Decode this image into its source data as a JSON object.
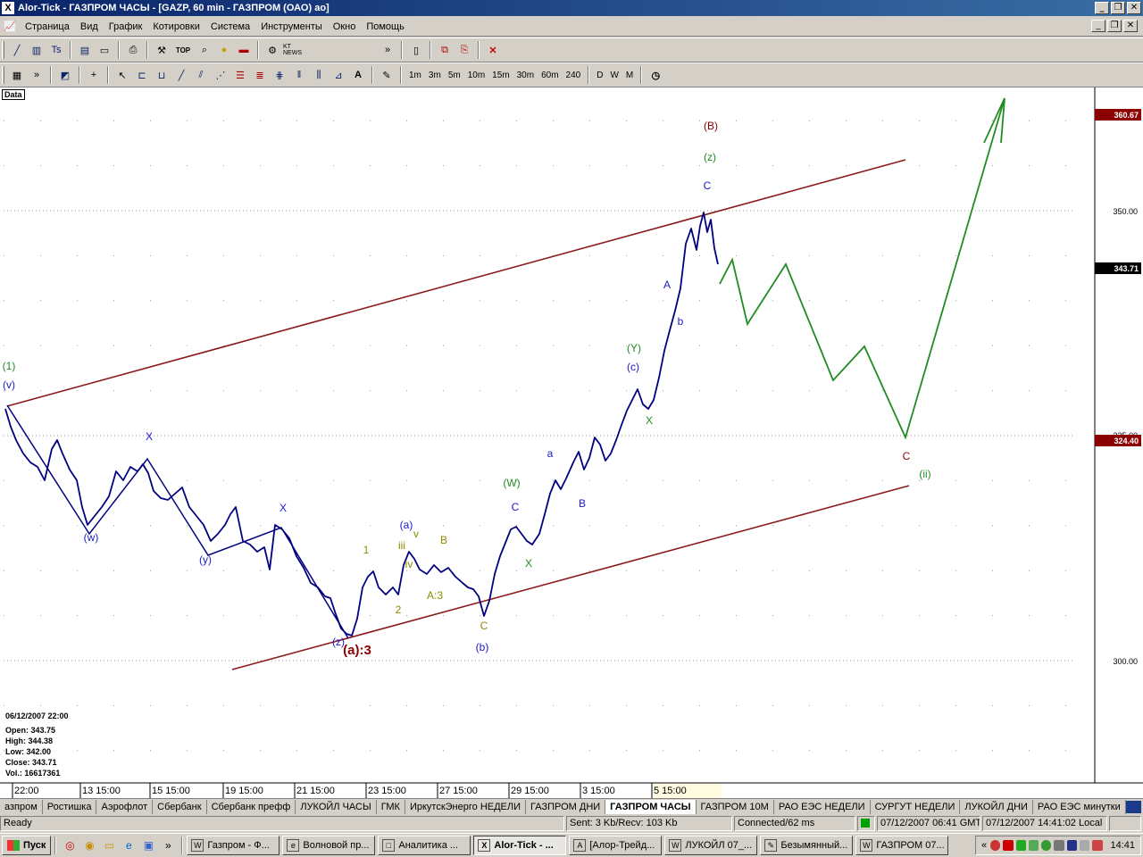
{
  "window": {
    "app_icon": "X",
    "title": "Alor-Tick - ГАЗПРОМ ЧАСЫ - [GAZP, 60 min - ГАЗПРОМ (ОАО) ао]",
    "minimize": "_",
    "restore": "❐",
    "close": "✕"
  },
  "menu": {
    "items": [
      "Страница",
      "Вид",
      "График",
      "Котировки",
      "Система",
      "Инструменты",
      "Окно",
      "Помощь"
    ]
  },
  "toolbar1": {
    "more": "»",
    "top_label": "TOP",
    "news_label": "KT NEWS"
  },
  "toolbar2": {
    "more": "»",
    "timeframes": [
      "1m",
      "3m",
      "5m",
      "10m",
      "15m",
      "30m",
      "60m",
      "240",
      "D",
      "W",
      "M"
    ]
  },
  "chart": {
    "data_label": "Data",
    "price_axis": {
      "ticks": [
        "350.00",
        "300.00"
      ],
      "hidden_tick": "325.00",
      "badges": [
        {
          "text": "360.67",
          "color": "#8b0000"
        },
        {
          "text": "343.71",
          "color": "#000000"
        },
        {
          "text": "324.40",
          "color": "#8b0000"
        }
      ]
    },
    "time_axis": [
      "22:00",
      "13 15:00",
      "15 15:00",
      "19 15:00",
      "21 15:00",
      "23 15:00",
      "27 15:00",
      "29 15:00",
      "3 15:00",
      "5 15:00"
    ],
    "info": {
      "date": "06/12/2007 22:00",
      "open": "Open: 343.75",
      "high": "High: 344.38",
      "low": "Low: 342.00",
      "close": "Close: 343.71",
      "volume": "Vol.: 16617361"
    },
    "wave_labels": [
      {
        "text": "(1)",
        "color": "#228b22"
      },
      {
        "text": "(v)",
        "color": "#1a1acd"
      },
      {
        "text": "(w)",
        "color": "#1a1acd"
      },
      {
        "text": "X",
        "color": "#1a1acd"
      },
      {
        "text": "(y)",
        "color": "#1a1acd"
      },
      {
        "text": "X",
        "color": "#1a1acd"
      },
      {
        "text": "(z)",
        "color": "#1a1acd"
      },
      {
        "text": "(a):3",
        "color": "#8b0000"
      },
      {
        "text": "1",
        "color": "#8b8b00"
      },
      {
        "text": "2",
        "color": "#8b8b00"
      },
      {
        "text": "iii",
        "color": "#8b8b00"
      },
      {
        "text": "(a)",
        "color": "#1a1acd"
      },
      {
        "text": "v",
        "color": "#8b8b00"
      },
      {
        "text": "iv",
        "color": "#8b8b00"
      },
      {
        "text": "B",
        "color": "#8b8b00"
      },
      {
        "text": "A:3",
        "color": "#8b8b00"
      },
      {
        "text": "C",
        "color": "#8b8b00"
      },
      {
        "text": "(b)",
        "color": "#1a1acd"
      },
      {
        "text": "(W)",
        "color": "#228b22"
      },
      {
        "text": "C",
        "color": "#1a1acd"
      },
      {
        "text": "X",
        "color": "#228b22"
      },
      {
        "text": "a",
        "color": "#1a1acd"
      },
      {
        "text": "B",
        "color": "#1a1acd"
      },
      {
        "text": "X",
        "color": "#228b22"
      },
      {
        "text": "(Y)",
        "color": "#228b22"
      },
      {
        "text": "(c)",
        "color": "#1a1acd"
      },
      {
        "text": "b",
        "color": "#1a1acd"
      },
      {
        "text": "A",
        "color": "#1a1acd"
      },
      {
        "text": "C",
        "color": "#1a1acd"
      },
      {
        "text": "(z)",
        "color": "#228b22"
      },
      {
        "text": "(B)",
        "color": "#8b0000"
      },
      {
        "text": "C",
        "color": "#8b0000"
      },
      {
        "text": "(ii)",
        "color": "#228b22"
      }
    ],
    "colors": {
      "price_line": "#000080",
      "channel": "#8b1a1a",
      "projection": "#228b22"
    }
  },
  "tabs": {
    "items": [
      "азпром",
      "Ростишка",
      "Аэрофлот",
      "Сбербанк",
      "Сбербанк префф",
      "ЛУКОЙЛ ЧАСЫ",
      "ГМК",
      "ИркутскЭнерго НЕДЕЛИ",
      "ГАЗПРОМ ДНИ",
      "ГАЗПРОМ ЧАСЫ",
      "ГАЗПРОМ 10М",
      "РАО ЕЭС НЕДЕЛИ",
      "СУРГУТ НЕДЕЛИ",
      "ЛУКОЙЛ ДНИ",
      "РАО ЕЭС минутки"
    ],
    "active_index": 9
  },
  "status": {
    "ready": "Ready",
    "traffic": "Sent: 3 Kb/Recv: 103 Kb",
    "connection": "Connected/62 ms",
    "gmt_time": "07/12/2007 06:41 GMT",
    "local_time": "07/12/2007 14:41:02 Local"
  },
  "taskbar": {
    "start": "Пуск",
    "tasks": [
      {
        "label": "Газпром - Ф...",
        "icon": "W"
      },
      {
        "label": "Волновой пр...",
        "icon": "e"
      },
      {
        "label": "Аналитика ...",
        "icon": "□"
      },
      {
        "label": "Alor-Tick - ...",
        "icon": "X"
      },
      {
        "label": "[Алор-Трейд...",
        "icon": "A"
      },
      {
        "label": "ЛУКОЙЛ 07_...",
        "icon": "W"
      },
      {
        "label": "Безымянный...",
        "icon": "✎"
      },
      {
        "label": "ГАЗПРОМ 07...",
        "icon": "W"
      }
    ],
    "active_task": 3,
    "tray_expand": "«",
    "clock": "14:41"
  }
}
